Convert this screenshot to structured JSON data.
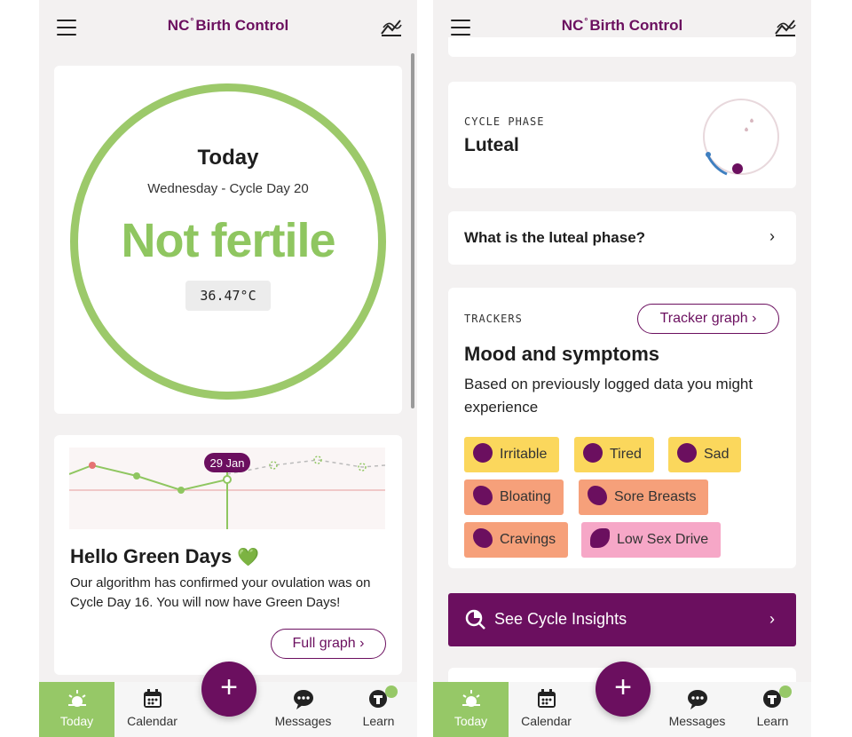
{
  "left": {
    "brand": {
      "prefix": "NC",
      "degree": "°",
      "name": "Birth Control"
    },
    "today": {
      "title": "Today",
      "subtitle": "Wednesday - Cycle Day 20",
      "status": "Not fertile",
      "temperature": "36.47°C"
    },
    "mini_graph": {
      "date_label": "29 Jan"
    },
    "green_days": {
      "title": "Hello Green Days",
      "emoji": "💚",
      "text": "Our algorithm has confirmed your ovulation was on Cycle Day 16. You will now have Green Days!",
      "button": "Full graph",
      "chevron": "›"
    },
    "nav": {
      "today": "Today",
      "calendar": "Calendar",
      "messages": "Messages",
      "learn": "Learn",
      "fab": "+"
    }
  },
  "right": {
    "brand": {
      "prefix": "NC",
      "degree": "°",
      "name": "Birth Control"
    },
    "phase": {
      "label": "CYCLE PHASE",
      "name": "Luteal"
    },
    "luteal_link": {
      "text": "What is the luteal phase?",
      "chevron": "›"
    },
    "trackers": {
      "label": "TRACKERS",
      "graph_button": "Tracker graph",
      "chevron": "›",
      "title": "Mood and symptoms",
      "description": "Based on previously logged data you might experience",
      "chips": [
        {
          "label": "Irritable",
          "icon": "irritable-face-icon",
          "color": "#fbd75c"
        },
        {
          "label": "Tired",
          "icon": "tired-face-icon",
          "color": "#fbd75c"
        },
        {
          "label": "Sad",
          "icon": "sad-face-icon",
          "color": "#fbd75c"
        },
        {
          "label": "Bloating",
          "icon": "bloating-icon",
          "color": "#f6a07a"
        },
        {
          "label": "Sore Breasts",
          "icon": "sore-breasts-icon",
          "color": "#f6a07a"
        },
        {
          "label": "Cravings",
          "icon": "cravings-icon",
          "color": "#f6a07a"
        },
        {
          "label": "Low Sex Drive",
          "icon": "low-sex-drive-icon",
          "color": "#f6a7c7"
        }
      ]
    },
    "insights": {
      "label": "See Cycle Insights",
      "chevron": "›"
    },
    "nav": {
      "today": "Today",
      "calendar": "Calendar",
      "messages": "Messages",
      "learn": "Learn",
      "fab": "+"
    }
  },
  "colors": {
    "brand_purple": "#6b0f5f",
    "fertile_green": "#96c867",
    "ring_green": "#9cc96a"
  }
}
